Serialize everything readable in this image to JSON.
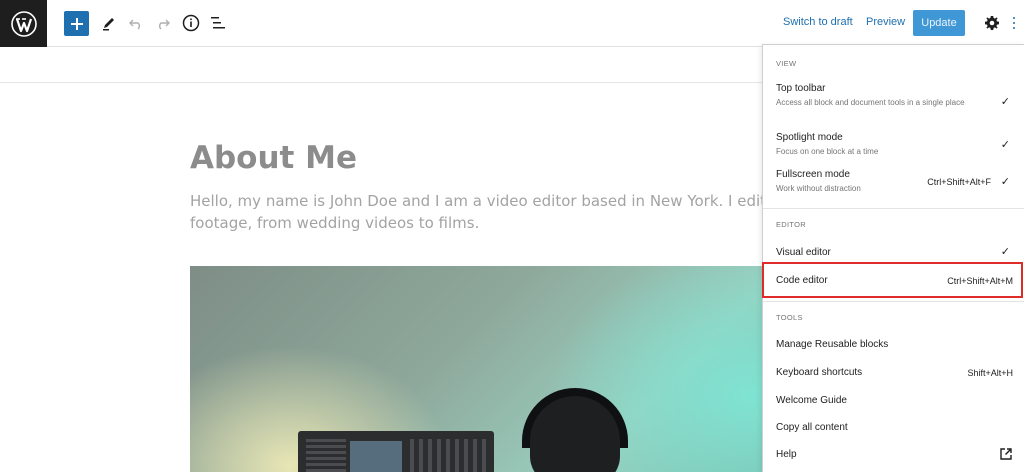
{
  "toolbar": {
    "switch_to_draft": "Switch to draft",
    "preview": "Preview",
    "update": "Update",
    "icons": [
      "wordpress-logo-icon",
      "plus-icon",
      "pencil-icon",
      "undo-icon",
      "redo-icon",
      "info-icon",
      "list-view-icon",
      "gear-icon",
      "more-options-icon"
    ]
  },
  "post": {
    "title": "About Me",
    "paragraph": "Hello, my name is John Doe and I am a video editor based in New York. I edit all k\nfootage, from wedding videos to films."
  },
  "menu": {
    "view": {
      "title": "VIEW",
      "items": [
        {
          "label": "Top toolbar",
          "desc": "Access all block and document tools in a single place",
          "checked": "✓",
          "shortcut": ""
        },
        {
          "label": "Spotlight mode",
          "desc": "Focus on one block at a time",
          "checked": "✓",
          "shortcut": ""
        },
        {
          "label": "Fullscreen mode",
          "desc": "Work without distraction",
          "checked": "✓",
          "shortcut": "Ctrl+Shift+Alt+F"
        }
      ]
    },
    "editor": {
      "title": "EDITOR",
      "items": [
        {
          "label": "Visual editor",
          "checked": "✓",
          "shortcut": ""
        },
        {
          "label": "Code editor",
          "checked": "",
          "shortcut": "Ctrl+Shift+Alt+M"
        }
      ]
    },
    "tools": {
      "title": "TOOLS",
      "items": [
        {
          "label": "Manage Reusable blocks",
          "shortcut": ""
        },
        {
          "label": "Keyboard shortcuts",
          "shortcut": "Shift+Alt+H"
        },
        {
          "label": "Welcome Guide",
          "shortcut": ""
        },
        {
          "label": "Copy all content",
          "shortcut": ""
        },
        {
          "label": "Help",
          "shortcut": ""
        }
      ]
    }
  },
  "colors": {
    "accent": "#1e70b0",
    "highlight": "#e02b2b"
  }
}
